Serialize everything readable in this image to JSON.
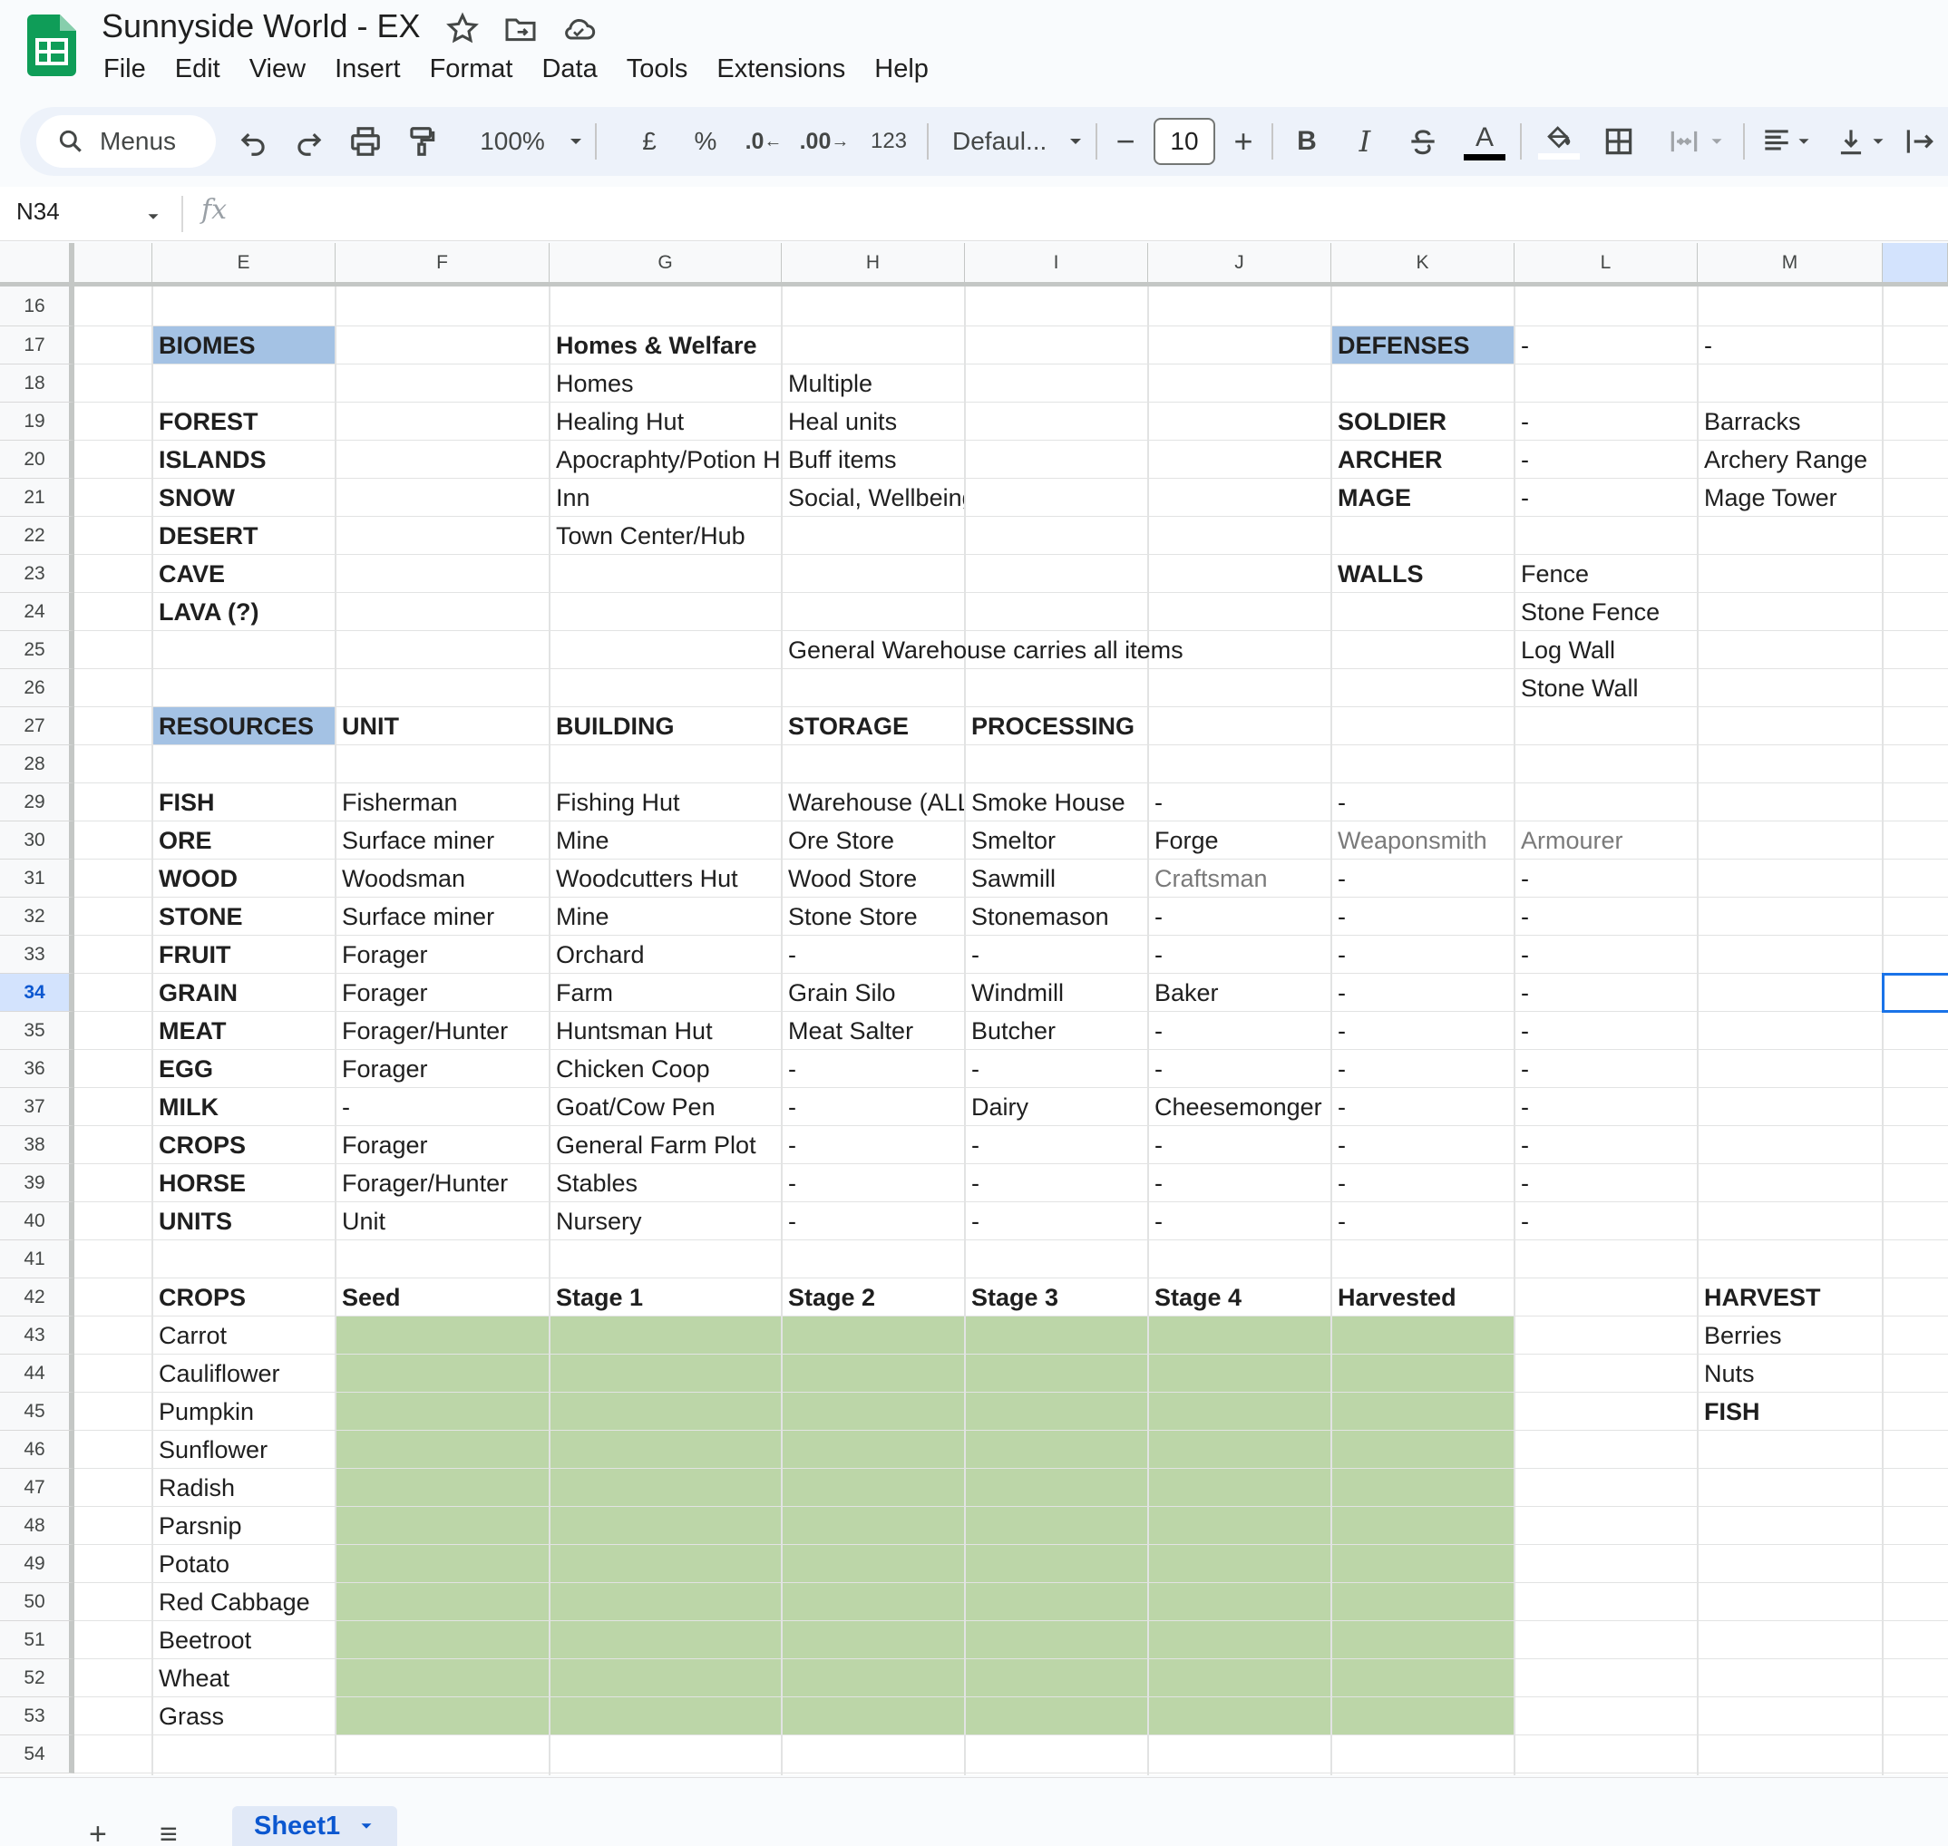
{
  "app": {
    "doc_title": "Sunnyside World - EX",
    "menu": [
      "File",
      "Edit",
      "View",
      "Insert",
      "Format",
      "Data",
      "Tools",
      "Extensions",
      "Help"
    ]
  },
  "toolbar": {
    "search_label": "Menus",
    "zoom": "100%",
    "currency": "£",
    "percent": "%",
    "decrease_decimal": ".0",
    "increase_decimal": ".00",
    "number_format": "123",
    "font": "Defaul...",
    "font_size": "10",
    "bold": "B",
    "italic": "I",
    "text_color_glyph": "A"
  },
  "formula_bar": {
    "cell_ref": "N34",
    "fx": "fx",
    "value": ""
  },
  "columns": [
    "E",
    "F",
    "G",
    "H",
    "I",
    "J",
    "K",
    "L",
    "M"
  ],
  "rows": [
    "16",
    "17",
    "18",
    "19",
    "20",
    "21",
    "22",
    "23",
    "24",
    "25",
    "26",
    "27",
    "28",
    "29",
    "30",
    "31",
    "32",
    "33",
    "34",
    "35",
    "36",
    "37",
    "38",
    "39",
    "40",
    "41",
    "42",
    "43",
    "44",
    "45",
    "46",
    "47",
    "48",
    "49",
    "50",
    "51",
    "52",
    "53",
    "54"
  ],
  "selected_row": "34",
  "sheet_data": {
    "17": {
      "E": "BIOMES",
      "G": "Homes & Welfare",
      "K": "DEFENSES",
      "L": "-",
      "M": "-"
    },
    "18": {
      "G": "Homes",
      "H": "Multiple"
    },
    "19": {
      "E": "FOREST",
      "G": "Healing Hut",
      "H": "Heal units",
      "K": "SOLDIER",
      "L": "-",
      "M": "Barracks"
    },
    "20": {
      "E": "ISLANDS",
      "G": "Apocraphty/Potion Hut",
      "H": "Buff items",
      "K": "ARCHER",
      "L": "-",
      "M": "Archery Range"
    },
    "21": {
      "E": "SNOW",
      "G": "Inn",
      "H": "Social, Wellbeing?",
      "K": "MAGE",
      "L": "-",
      "M": "Mage Tower"
    },
    "22": {
      "E": "DESERT",
      "G": "Town Center/Hub"
    },
    "23": {
      "E": "CAVE",
      "K": "WALLS",
      "L": "Fence"
    },
    "24": {
      "E": "LAVA (?)",
      "L": "Stone Fence"
    },
    "25": {
      "H": "General Warehouse carries all items",
      "L": "Log Wall"
    },
    "26": {
      "L": "Stone Wall"
    },
    "27": {
      "E": "RESOURCES",
      "F": "UNIT",
      "G": "BUILDING",
      "H": "STORAGE",
      "I": "PROCESSING"
    },
    "29": {
      "E": "FISH",
      "F": "Fisherman",
      "G": "Fishing Hut",
      "H": "Warehouse (ALL)",
      "I": "Smoke House",
      "J": "-",
      "K": "-"
    },
    "30": {
      "E": "ORE",
      "F": "Surface miner",
      "G": "Mine",
      "H": "Ore Store",
      "I": "Smeltor",
      "J": "Forge",
      "K": "Weaponsmith",
      "L": "Armourer"
    },
    "31": {
      "E": "WOOD",
      "F": "Woodsman",
      "G": "Woodcutters Hut",
      "H": "Wood Store",
      "I": "Sawmill",
      "J": "Craftsman",
      "K": "-",
      "L": "-"
    },
    "32": {
      "E": "STONE",
      "F": "Surface miner",
      "G": "Mine",
      "H": "Stone Store",
      "I": "Stonemason",
      "J": "-",
      "K": "-",
      "L": "-"
    },
    "33": {
      "E": "FRUIT",
      "F": "Forager",
      "G": "Orchard",
      "H": "-",
      "I": "-",
      "J": "-",
      "K": "-",
      "L": "-"
    },
    "34": {
      "E": "GRAIN",
      "F": "Forager",
      "G": "Farm",
      "H": "Grain Silo",
      "I": "Windmill",
      "J": "Baker",
      "K": "-",
      "L": "-"
    },
    "35": {
      "E": "MEAT",
      "F": "Forager/Hunter",
      "G": "Huntsman Hut",
      "H": "Meat Salter",
      "I": "Butcher",
      "J": "-",
      "K": "-",
      "L": "-"
    },
    "36": {
      "E": "EGG",
      "F": "Forager",
      "G": "Chicken Coop",
      "H": "-",
      "I": "-",
      "J": "-",
      "K": "-",
      "L": "-"
    },
    "37": {
      "E": "MILK",
      "F": "-",
      "G": "Goat/Cow Pen",
      "H": "-",
      "I": "Dairy",
      "J": "Cheesemonger",
      "K": "-",
      "L": "-"
    },
    "38": {
      "E": "CROPS",
      "F": "Forager",
      "G": "General Farm Plot",
      "H": "-",
      "I": "-",
      "J": "-",
      "K": "-",
      "L": "-"
    },
    "39": {
      "E": "HORSE",
      "F": "Forager/Hunter",
      "G": "Stables",
      "H": "-",
      "I": "-",
      "J": "-",
      "K": "-",
      "L": "-"
    },
    "40": {
      "E": "UNITS",
      "F": "Unit",
      "G": "Nursery",
      "H": "-",
      "I": "-",
      "J": "-",
      "K": "-",
      "L": "-"
    },
    "42": {
      "E": "CROPS",
      "F": "Seed",
      "G": "Stage 1",
      "H": "Stage 2",
      "I": "Stage 3",
      "J": "Stage 4",
      "K": "Harvested",
      "M": "HARVEST"
    },
    "43": {
      "E": "Carrot",
      "M": "Berries"
    },
    "44": {
      "E": "Cauliflower",
      "M": "Nuts"
    },
    "45": {
      "E": "Pumpkin",
      "M": "FISH"
    },
    "46": {
      "E": "Sunflower"
    },
    "47": {
      "E": "Radish"
    },
    "48": {
      "E": "Parsnip"
    },
    "49": {
      "E": "Potato"
    },
    "50": {
      "E": "Red Cabbage"
    },
    "51": {
      "E": "Beetroot"
    },
    "52": {
      "E": "Wheat"
    },
    "53": {
      "E": "Grass"
    }
  },
  "bold_cells": [
    "E17",
    "G17",
    "K17",
    "E19",
    "E20",
    "E21",
    "E22",
    "E23",
    "E24",
    "K19",
    "K20",
    "K21",
    "K23",
    "E27",
    "F27",
    "G27",
    "H27",
    "I27",
    "E29",
    "E30",
    "E31",
    "E32",
    "E33",
    "E34",
    "E35",
    "E36",
    "E37",
    "E38",
    "E39",
    "E40",
    "E42",
    "F42",
    "G42",
    "H42",
    "I42",
    "J42",
    "K42",
    "M42",
    "M45"
  ],
  "grey_cells": [
    "K30",
    "L30",
    "J31"
  ],
  "overflow_cells": [
    "H25"
  ],
  "colors": {
    "header_fill": "#a4c2e4",
    "crop_stage_fill": "#bcd6a8",
    "selection": "#1a73e8",
    "sheets_green": "#0f9d58"
  },
  "sheets": {
    "active_tab": "Sheet1",
    "add_icon": "plus-icon",
    "list_icon": "hamburger-icon"
  }
}
